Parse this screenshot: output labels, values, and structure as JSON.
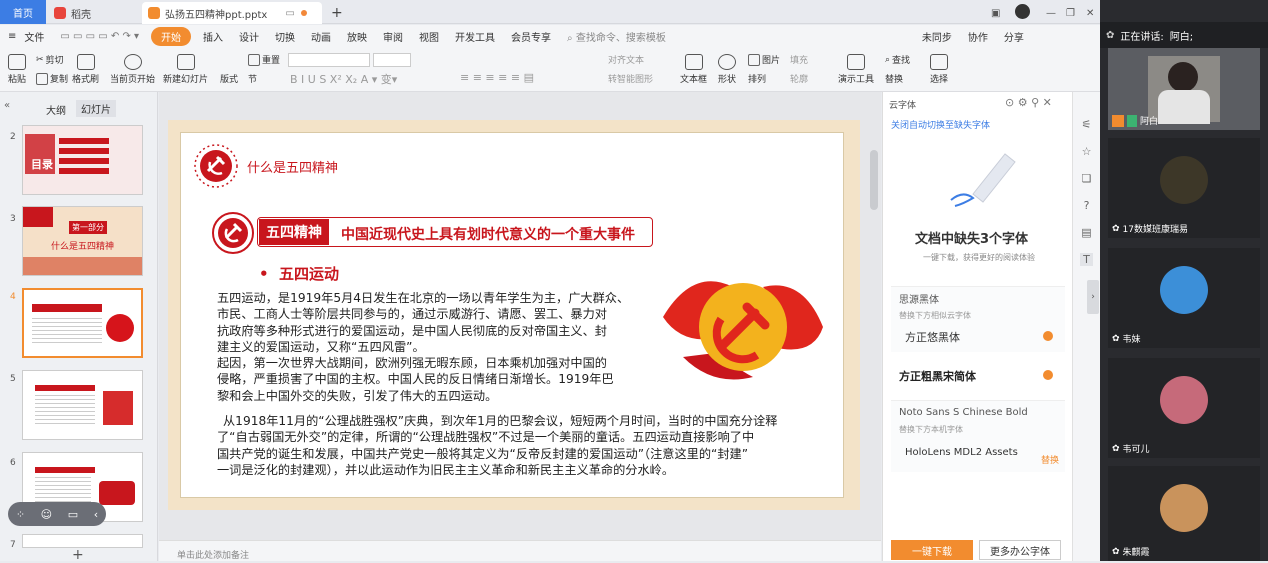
{
  "tabs": {
    "home": "首页",
    "daoke": "稻壳",
    "doc": "弘扬五四精神ppt.pptx"
  },
  "menu": {
    "file": "文件",
    "items": [
      "开始",
      "插入",
      "设计",
      "切换",
      "动画",
      "放映",
      "审阅",
      "视图",
      "开发工具",
      "会员专享"
    ],
    "search": "查找命令、搜索模板",
    "unsync": "未同步",
    "collab": "协作",
    "share": "分享"
  },
  "ribbon": {
    "paste": "粘贴",
    "cut": "剪切",
    "copy": "复制",
    "format_painter": "格式刷",
    "from_current": "当前页开始",
    "new_slide": "新建幻灯片",
    "layout": "版式",
    "section": "节",
    "reset": "重置",
    "align_text": "对齐文本",
    "to_smartart": "转智能图形",
    "textbox": "文本框",
    "shape": "形状",
    "arrange": "排列",
    "picture": "图片",
    "fill": "填充",
    "outline": "轮廓",
    "present_tools": "演示工具",
    "find": "查找",
    "replace": "替换",
    "select": "选择"
  },
  "left": {
    "tab_outline": "大纲",
    "tab_slides": "幻灯片",
    "numbers": [
      "2",
      "3",
      "4",
      "5",
      "6",
      "7"
    ],
    "t2_title": "目录",
    "t3_part": "第一部分",
    "t3_title": "什么是五四精神"
  },
  "slide": {
    "header": "什么是五四精神",
    "badge": "五四精神",
    "banner": "中国近现代史上具有划时代意义的一个重大事件",
    "bullet": "五四运动",
    "p1": [
      "五四运动，是1919年5月4日发生在北京的一场以青年学生为主，广大群众、",
      "市民、工商人士等阶层共同参与的，通过示威游行、请愿、罢工、暴力对",
      "抗政府等多种形式进行的爱国运动，是中国人民彻底的反对帝国主义、封",
      "建主义的爱国运动，又称“五四风雷”。",
      "起因，第一次世界大战期间，欧洲列强无暇东顾，日本乘机加强对中国的",
      "侵略，严重损害了中国的主权。中国人民的反日情绪日渐增长。1919年巴",
      "黎和会上中国外交的失败，引发了伟大的五四运动。"
    ],
    "p2": [
      "从1918年11月的“公理战胜强权”庆典，到次年1月的巴黎会议，短短两个月时间，当时的中国充分诠释",
      "了“自古弱国无外交”的定律，所谓的“公理战胜强权”不过是一个美丽的童话。五四运动直接影响了中",
      "国共产党的诞生和发展，中国共产党史一般将其定义为“反帝反封建的爱国运动”（注意这里的“封建”",
      "一词是泛化的封建观），并以此运动作为旧民主主义革命和新民主主义革命的分水岭。"
    ],
    "notes": "单击此处添加备注"
  },
  "fontpanel": {
    "title": "云字体",
    "link": "关闭自动切换至缺失字体",
    "heading": "文档中缺失3个字体",
    "sub": "一键下载，获得更好的阅读体验",
    "f1_missing": "思源黑体",
    "f1_hint": "替换下方相似云字体",
    "f1_repl": "方正悠黑体",
    "f2": "方正粗黑宋简体",
    "f3_missing": "Noto Sans S Chinese Bold",
    "f3_hint": "替换下方本机字体",
    "f3_repl": "HoloLens MDL2 Assets",
    "f3_tag": "替换",
    "download": "一键下载",
    "more": "更多办公字体"
  },
  "video": {
    "speaking_label": "正在讲话:",
    "speaking_name": "阿白;",
    "participants": [
      "阿白",
      "17数媒班康瑞易",
      "韦妹",
      "韦可儿",
      "朱麒霞"
    ]
  },
  "colors": {
    "accent": "#f28c2f",
    "red": "#c8161d",
    "blue": "#3c7de4"
  }
}
